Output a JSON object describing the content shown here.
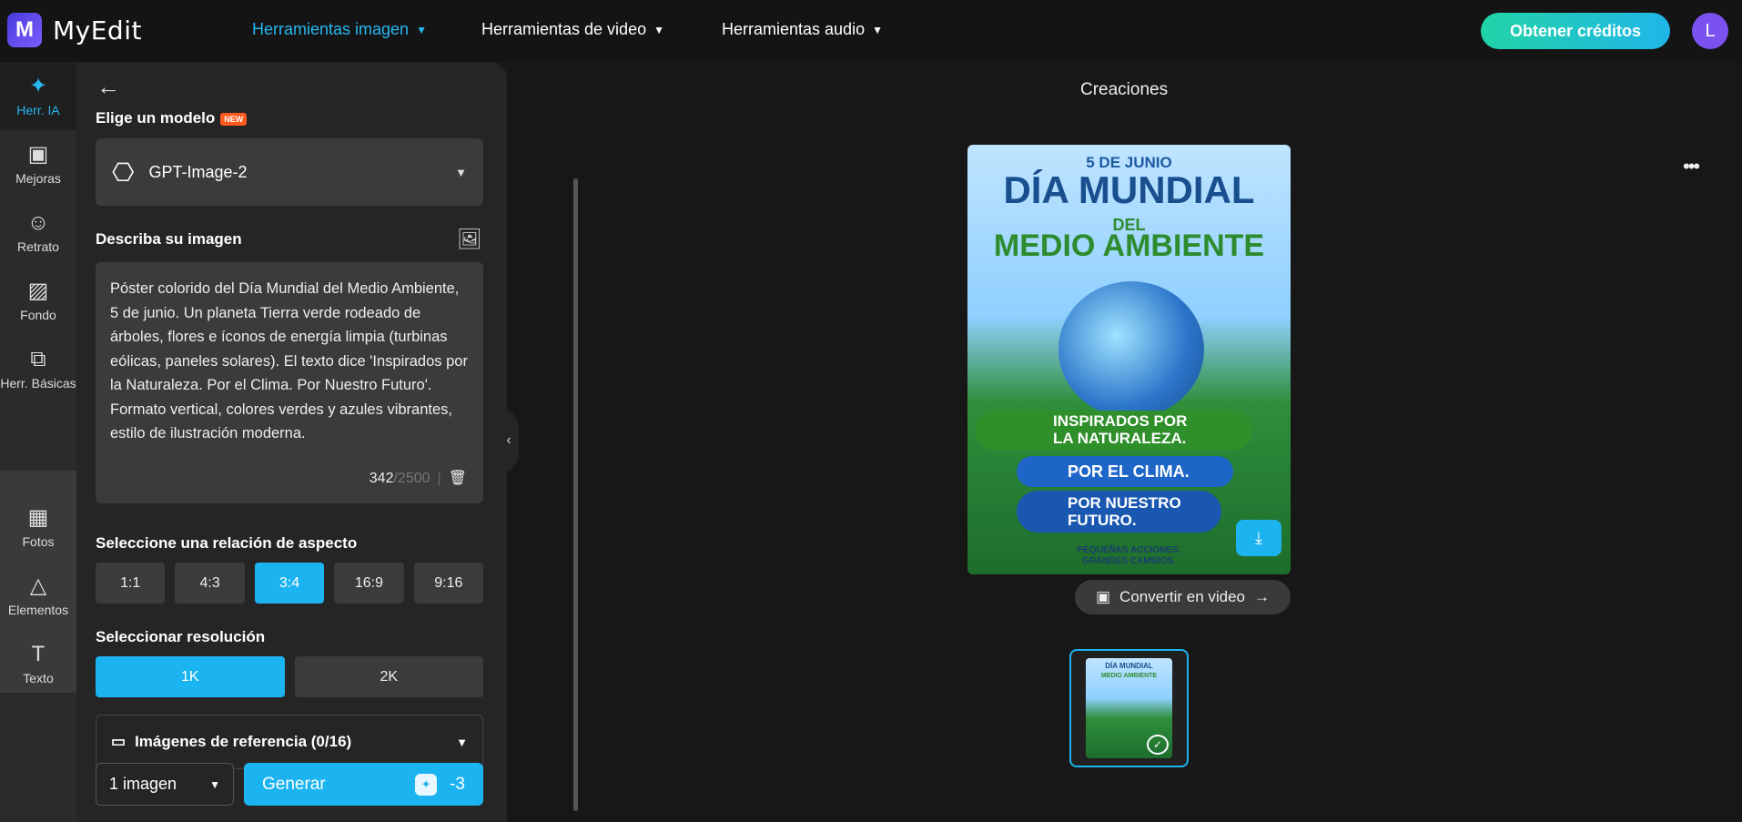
{
  "header": {
    "logo_text": "MyEdit",
    "logo_mark": "M",
    "nav": [
      "Herramientas imagen",
      "Herramientas de video",
      "Herramientas audio"
    ],
    "credits_button": "Obtener créditos",
    "avatar_initial": "L"
  },
  "rail": {
    "items": [
      {
        "label": "Herr. IA",
        "icon": "magic-wand"
      },
      {
        "label": "Mejoras",
        "icon": "image-enhance"
      },
      {
        "label": "Retrato",
        "icon": "portrait"
      },
      {
        "label": "Fondo",
        "icon": "background"
      },
      {
        "label": "Herr. Básicas",
        "icon": "crop"
      },
      {
        "label": "Fotos",
        "icon": "photo"
      },
      {
        "label": "Elementos",
        "icon": "shapes"
      },
      {
        "label": "Texto",
        "icon": "text-T"
      }
    ]
  },
  "panel": {
    "model_label": "Elige un modelo",
    "new_badge": "NEW",
    "model_value": "GPT-Image-2",
    "describe_label": "Describa su imagen",
    "prompt": "Póster colorido del Día Mundial del Medio Ambiente, 5 de junio. Un planeta Tierra verde rodeado de árboles, flores e íconos de energía limpia (turbinas eólicas, paneles solares). El texto dice 'Inspirados por la Naturaleza. Por el Clima. Por Nuestro Futuro'. Formato vertical, colores verdes y azules vibrantes, estilo de ilustración moderna.",
    "char_count": "342",
    "char_max": "/2500",
    "char_sep": "|",
    "aspect_label": "Seleccione una relación de aspecto",
    "aspects": [
      "1:1",
      "4:3",
      "3:4",
      "16:9",
      "9:16"
    ],
    "aspect_selected": "3:4",
    "resolution_label": "Seleccionar resolución",
    "resolutions": [
      "1K",
      "2K"
    ],
    "resolution_selected": "1K",
    "reference_label": "Imágenes de referencia (0/16)",
    "count_value": "1 imagen",
    "generate_label": "Generar",
    "generate_cost": "-3"
  },
  "main": {
    "title": "Creaciones",
    "convert_video": "Convertir en video",
    "poster": {
      "date": "5 DE JUNIO",
      "title1": "DÍA MUNDIAL",
      "title2": "DEL",
      "title3": "MEDIO AMBIENTE",
      "line1a": "INSPIRADOS POR",
      "line1b": "LA NATURALEZA.",
      "line2": "POR EL CLIMA.",
      "line3a": "POR NUESTRO",
      "line3b": "FUTURO.",
      "footer1": "PEQUEÑAS ACCIONES,",
      "footer2": "GRANDES CAMBIOS."
    }
  }
}
